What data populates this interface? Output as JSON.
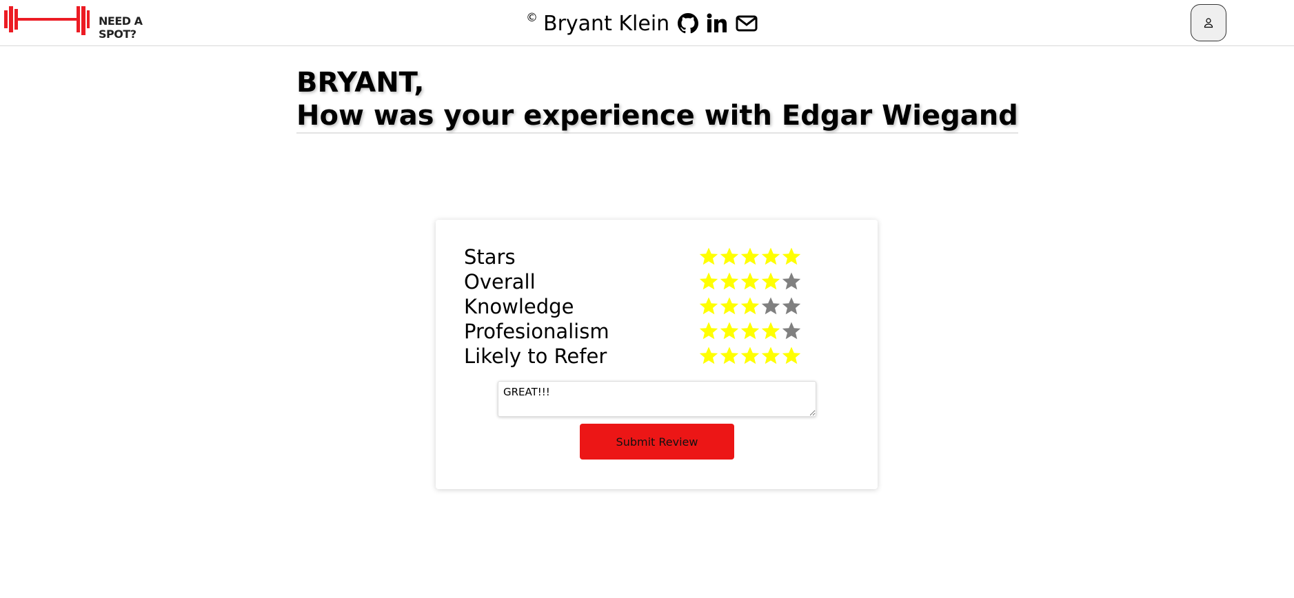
{
  "header": {
    "logo_text": "NEED A SPOT?",
    "copyright_symbol": "©",
    "author_name": "Bryant Klein",
    "icons": [
      "github-icon",
      "linkedin-icon",
      "mail-icon"
    ],
    "user_icon": "user-icon"
  },
  "main": {
    "greeting": "BRYANT,",
    "question": "How was your experience with Edgar Wiegand"
  },
  "review": {
    "max_stars": 5,
    "ratings": [
      {
        "label": "Stars",
        "value": 5
      },
      {
        "label": "Overall",
        "value": 4
      },
      {
        "label": "Knowledge",
        "value": 3
      },
      {
        "label": "Profesionalism",
        "value": 4
      },
      {
        "label": "Likely to Refer",
        "value": 5
      }
    ],
    "comment": "GREAT!!!",
    "submit_label": "Submit Review"
  },
  "colors": {
    "brand": "#ec1616",
    "star_filled": "#ffff00",
    "star_empty": "#808080"
  }
}
